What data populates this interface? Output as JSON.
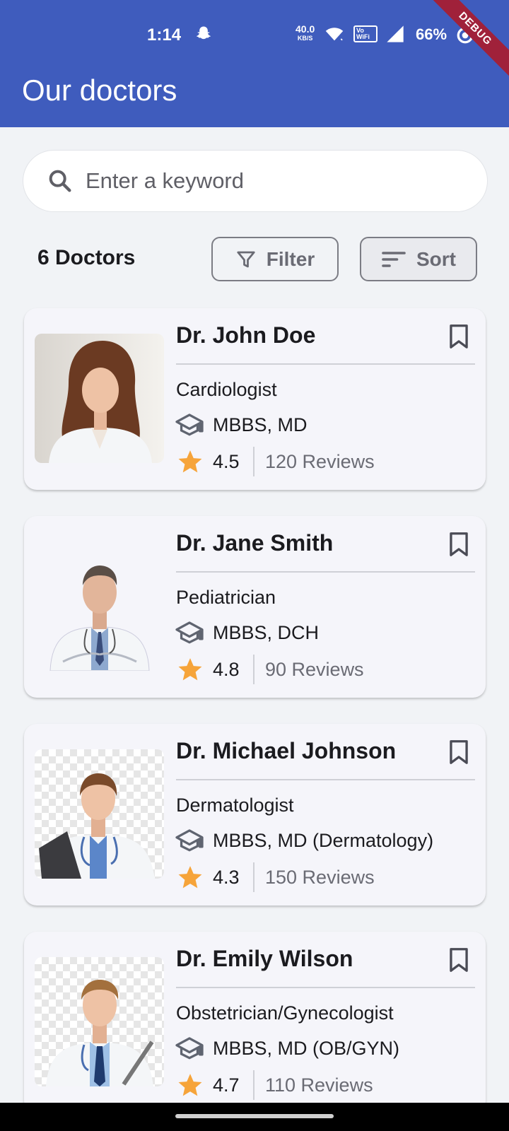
{
  "status_bar": {
    "time": "1:14",
    "net_speed_value": "40.0",
    "net_speed_unit": "KB/S",
    "vowifi": "Vo WiFi",
    "battery": "66%",
    "debug_banner": "DEBUG"
  },
  "appbar": {
    "title": "Our doctors"
  },
  "search": {
    "placeholder": "Enter a keyword",
    "value": ""
  },
  "toolbar": {
    "count": "6 Doctors",
    "filter_label": "Filter",
    "sort_label": "Sort"
  },
  "doctors": [
    {
      "name": "Dr. John Doe",
      "specialty": "Cardiologist",
      "degree": "MBBS, MD",
      "rating": "4.5",
      "reviews": "120 Reviews"
    },
    {
      "name": "Dr. Jane Smith",
      "specialty": "Pediatrician",
      "degree": "MBBS, DCH",
      "rating": "4.8",
      "reviews": "90 Reviews"
    },
    {
      "name": "Dr. Michael Johnson",
      "specialty": "Dermatologist",
      "degree": "MBBS, MD (Dermatology)",
      "rating": "4.3",
      "reviews": "150 Reviews"
    },
    {
      "name": "Dr. Emily Wilson",
      "specialty": "Obstetrician/Gynecologist",
      "degree": "MBBS, MD (OB/GYN)",
      "rating": "4.7",
      "reviews": "110 Reviews"
    }
  ],
  "colors": {
    "app_bar": "#3f5cbd",
    "star": "#f6a43a",
    "background": "#f1f3f6",
    "card": "#f5f5fa"
  },
  "icons": [
    "search-icon",
    "filter-icon",
    "sort-icon",
    "bookmark-icon",
    "graduation-cap-icon",
    "star-icon"
  ]
}
